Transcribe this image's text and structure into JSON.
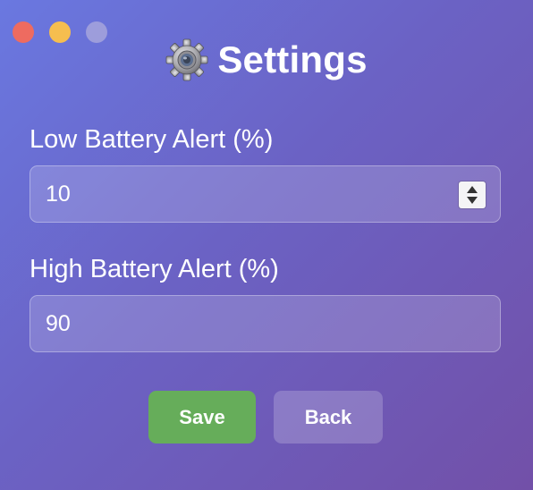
{
  "window": {
    "controls": [
      "close",
      "minimize",
      "maximize"
    ]
  },
  "header": {
    "icon": "gear-icon",
    "title": "Settings"
  },
  "form": {
    "low": {
      "label": "Low Battery Alert (%)",
      "value": "10"
    },
    "high": {
      "label": "High Battery Alert (%)",
      "value": "90"
    }
  },
  "buttons": {
    "save": "Save",
    "back": "Back"
  },
  "colors": {
    "save_button": "#66ad5a",
    "close_dot": "#ee6b60",
    "minimize_dot": "#f6be4f",
    "maximize_dot": "#a6a4dc"
  }
}
